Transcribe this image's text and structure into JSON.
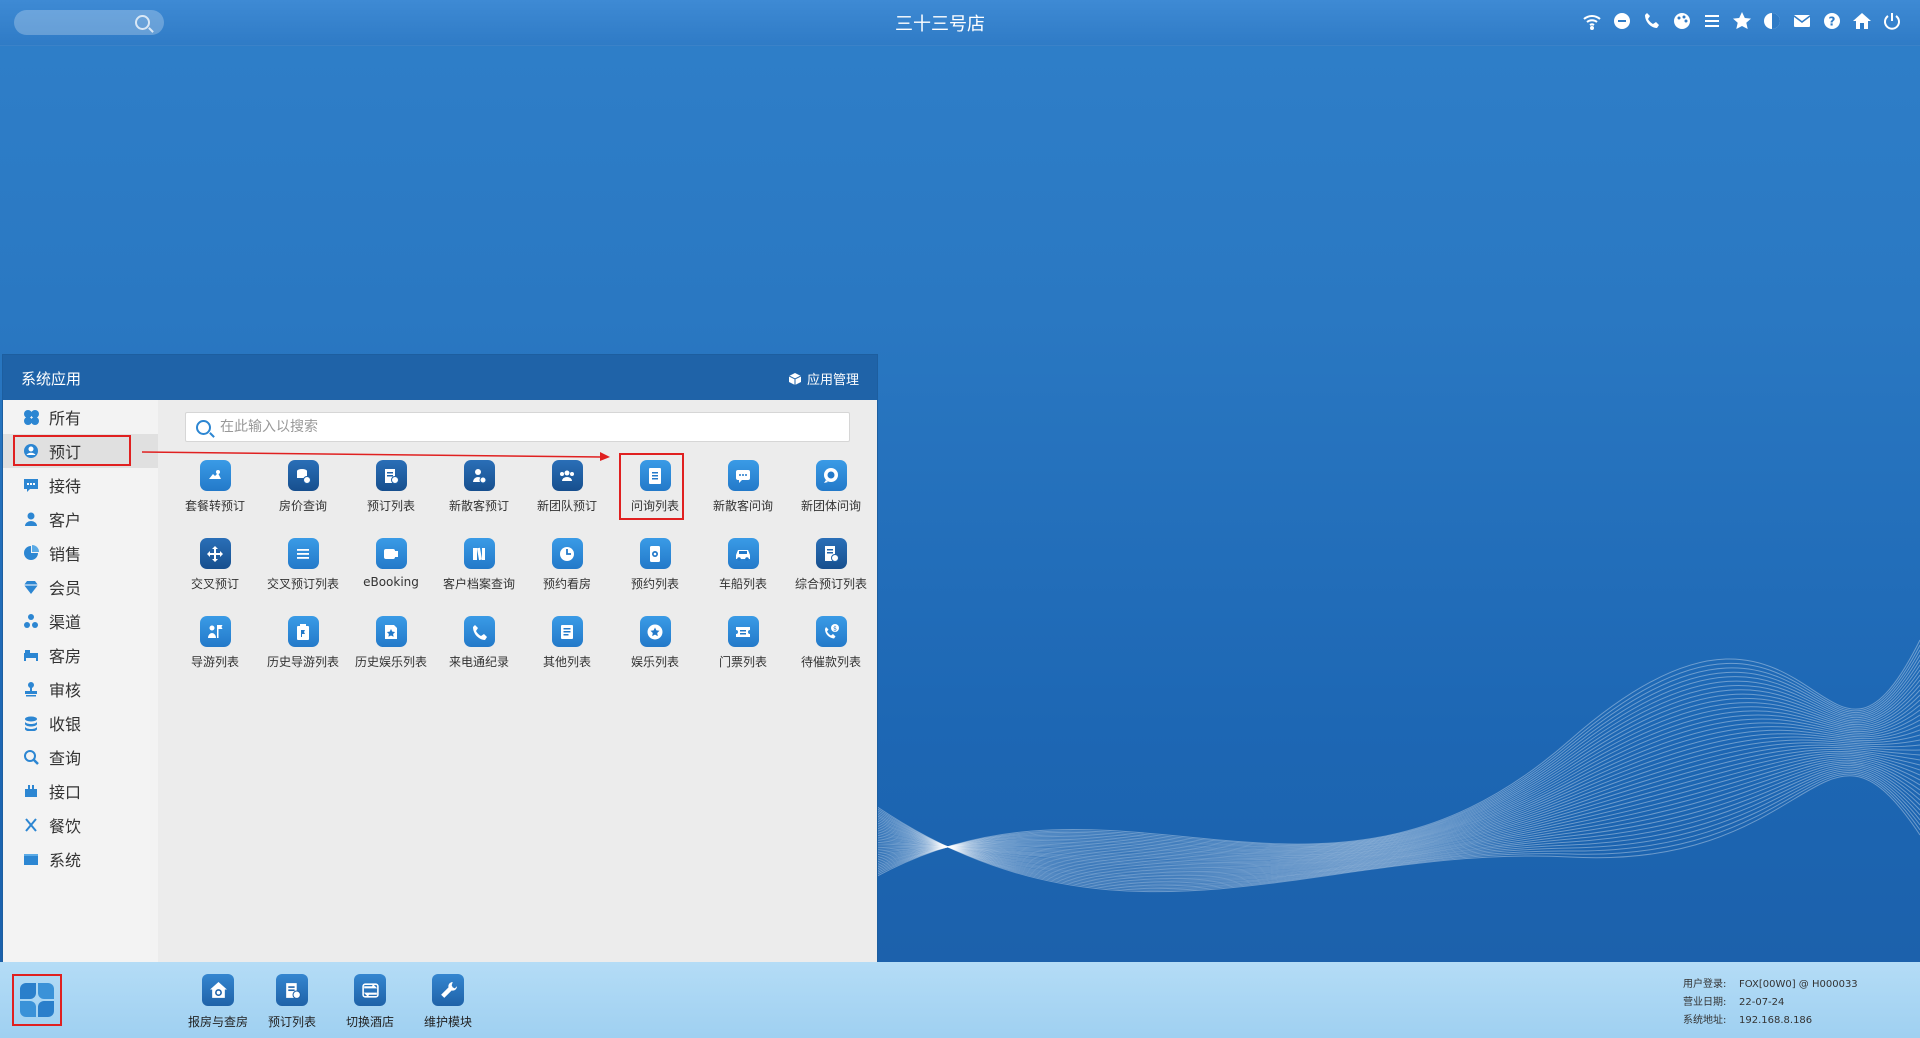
{
  "topbar": {
    "title": "三十三号店",
    "icons": [
      "wifi-icon",
      "chat-icon",
      "phone-icon",
      "palette-icon",
      "menu-icon",
      "star-icon",
      "half-moon-icon",
      "mail-icon",
      "help-icon",
      "home-icon",
      "power-icon"
    ]
  },
  "app": {
    "title": "系统应用",
    "manage_label": "应用管理",
    "search_placeholder": "在此输入以搜索",
    "sidebar": [
      {
        "label": "所有",
        "icon": "grid-icon"
      },
      {
        "label": "预订",
        "icon": "user-circle-icon",
        "active": true
      },
      {
        "label": "接待",
        "icon": "message-icon"
      },
      {
        "label": "客户",
        "icon": "person-icon"
      },
      {
        "label": "销售",
        "icon": "pie-icon"
      },
      {
        "label": "会员",
        "icon": "diamond-icon"
      },
      {
        "label": "渠道",
        "icon": "nodes-icon"
      },
      {
        "label": "客房",
        "icon": "bed-icon"
      },
      {
        "label": "审核",
        "icon": "stamp-icon"
      },
      {
        "label": "收银",
        "icon": "coins-icon"
      },
      {
        "label": "查询",
        "icon": "search-icon"
      },
      {
        "label": "接口",
        "icon": "plug-icon"
      },
      {
        "label": "餐饮",
        "icon": "utensils-icon"
      },
      {
        "label": "系统",
        "icon": "window-icon"
      }
    ],
    "tiles": [
      {
        "label": "套餐转预订",
        "icon": "package-icon"
      },
      {
        "label": "房价查询",
        "icon": "price-icon",
        "dark": true
      },
      {
        "label": "预订列表",
        "icon": "list-doc-icon",
        "dark": true
      },
      {
        "label": "新散客预订",
        "icon": "add-person-icon",
        "dark": true
      },
      {
        "label": "新团队预订",
        "icon": "group-icon",
        "dark": true
      },
      {
        "label": "问询列表",
        "icon": "document-icon",
        "selected": true
      },
      {
        "label": "新散客问询",
        "icon": "chat-bubble-icon"
      },
      {
        "label": "新团体问询",
        "icon": "chat-circle-icon"
      },
      {
        "label": "交叉预订",
        "icon": "move-icon",
        "dark": true
      },
      {
        "label": "交叉预订列表",
        "icon": "lines-icon"
      },
      {
        "label": "eBooking",
        "icon": "ticket-icon"
      },
      {
        "label": "客户档案查询",
        "icon": "books-icon"
      },
      {
        "label": "预约看房",
        "icon": "clock-icon"
      },
      {
        "label": "预约列表",
        "icon": "phone-doc-icon"
      },
      {
        "label": "车船列表",
        "icon": "car-icon"
      },
      {
        "label": "综合预订列表",
        "icon": "doc-gear-icon",
        "dark": true
      },
      {
        "label": "导游列表",
        "icon": "guide-flag-icon"
      },
      {
        "label": "历史导游列表",
        "icon": "clipboard-flag-icon"
      },
      {
        "label": "历史娱乐列表",
        "icon": "star-doc-icon"
      },
      {
        "label": "来电通纪录",
        "icon": "phone-icon"
      },
      {
        "label": "其他列表",
        "icon": "note-icon"
      },
      {
        "label": "娱乐列表",
        "icon": "star-circle-icon"
      },
      {
        "label": "门票列表",
        "icon": "ticket-stub-icon"
      },
      {
        "label": "待催款列表",
        "icon": "phone-money-icon"
      }
    ]
  },
  "taskbar": {
    "items": [
      {
        "label": "报房与查房",
        "icon": "house-search-icon"
      },
      {
        "label": "预订列表",
        "icon": "list-doc-icon"
      },
      {
        "label": "切换酒店",
        "icon": "switch-icon"
      },
      {
        "label": "维护模块",
        "icon": "wrench-icon"
      }
    ],
    "status": {
      "user_label": "用户登录:",
      "user_value": "FOX[00W0] @ H000033",
      "date_label": "营业日期:",
      "date_value": "22-07-24",
      "ip_label": "系统地址:",
      "ip_value": "192.168.8.186"
    }
  }
}
